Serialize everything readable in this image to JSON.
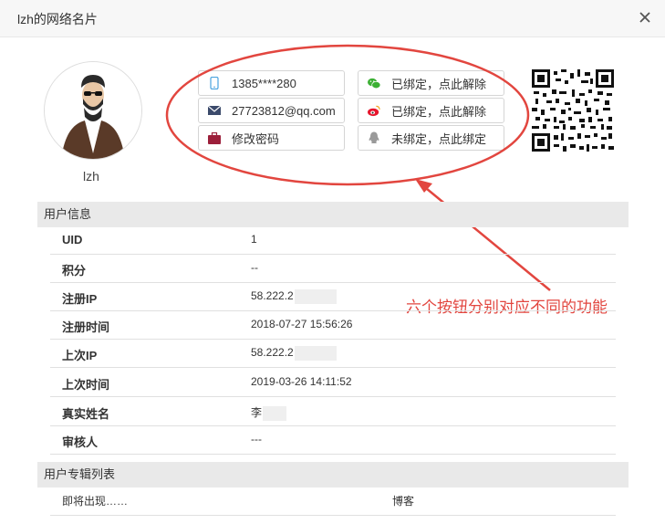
{
  "window": {
    "title": "lzh的网络名片"
  },
  "profile": {
    "username": "lzh"
  },
  "account_buttons": {
    "phone": "1385****280",
    "email": "27723812@qq.com",
    "password": "修改密码",
    "wechat": "已绑定，点此解除",
    "weibo": "已绑定，点此解除",
    "qq": "未绑定，点此绑定"
  },
  "annotation": "六个按钮分别对应不同的功能",
  "user_info": {
    "heading": "用户信息",
    "rows": [
      {
        "label": "UID",
        "value": "1"
      },
      {
        "label": "积分",
        "value": "--"
      },
      {
        "label": "注册IP",
        "value": "58.222.2"
      },
      {
        "label": "注册时间",
        "value": "2018-07-27 15:56:26"
      },
      {
        "label": "上次IP",
        "value": "58.222.2"
      },
      {
        "label": "上次时间",
        "value": "2019-03-26 14:11:52"
      },
      {
        "label": "真实姓名",
        "value": "李"
      },
      {
        "label": "审核人",
        "value": "---"
      }
    ]
  },
  "album_list": {
    "heading": "用户专辑列表",
    "item_text": "即将出现……",
    "item_type": "博客"
  },
  "colors": {
    "accent_red": "#e2463f",
    "wechat": "#3cb034",
    "email_icon": "#3b4a6b",
    "lock": "#9c1f3a"
  }
}
